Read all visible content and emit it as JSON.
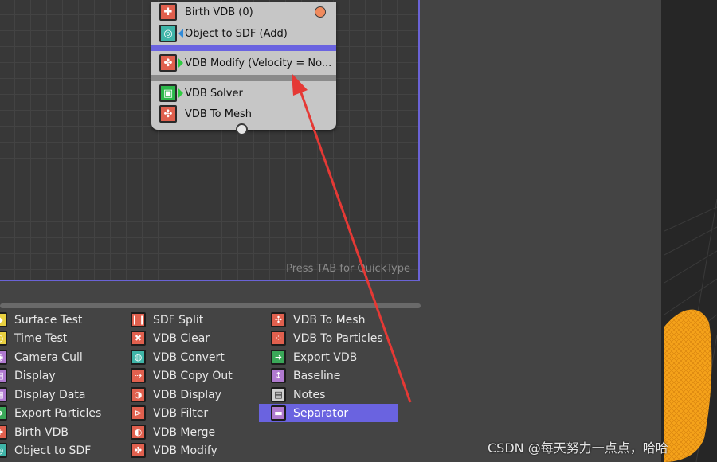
{
  "node": {
    "rows": [
      {
        "label": "Birth VDB (0)",
        "icon": "birth-vdb-icon"
      },
      {
        "label": "Object to SDF (Add)",
        "icon": "object-to-sdf-icon"
      },
      {
        "label": "VDB Modify (Velocity = No...",
        "icon": "vdb-modify-icon"
      },
      {
        "label": "VDB Solver",
        "icon": "vdb-solver-icon"
      },
      {
        "label": "VDB To Mesh",
        "icon": "vdb-to-mesh-icon"
      }
    ]
  },
  "editor": {
    "hint": "Press TAB for QuickType"
  },
  "palette": {
    "col1": [
      {
        "label": "Surface Test",
        "icon": "surface-test-icon"
      },
      {
        "label": "Time Test",
        "icon": "time-test-icon"
      },
      {
        "label": "Camera Cull",
        "icon": "camera-cull-icon"
      },
      {
        "label": "Display",
        "icon": "display-icon"
      },
      {
        "label": "Display Data",
        "icon": "display-data-icon"
      },
      {
        "label": "Export Particles",
        "icon": "export-particles-icon"
      },
      {
        "label": "Birth VDB",
        "icon": "birth-vdb-icon"
      },
      {
        "label": "Object to SDF",
        "icon": "object-to-sdf-icon"
      }
    ],
    "col2": [
      {
        "label": "SDF Split",
        "icon": "sdf-split-icon"
      },
      {
        "label": "VDB Clear",
        "icon": "vdb-clear-icon"
      },
      {
        "label": "VDB Convert",
        "icon": "vdb-convert-icon"
      },
      {
        "label": "VDB Copy Out",
        "icon": "vdb-copy-out-icon"
      },
      {
        "label": "VDB Display",
        "icon": "vdb-display-icon"
      },
      {
        "label": "VDB Filter",
        "icon": "vdb-filter-icon"
      },
      {
        "label": "VDB Merge",
        "icon": "vdb-merge-icon"
      },
      {
        "label": "VDB Modify",
        "icon": "vdb-modify-icon"
      }
    ],
    "col3": [
      {
        "label": "VDB To Mesh",
        "icon": "vdb-to-mesh-icon"
      },
      {
        "label": "VDB To Particles",
        "icon": "vdb-to-particles-icon"
      },
      {
        "label": "Export VDB",
        "icon": "export-vdb-icon"
      },
      {
        "label": "Baseline",
        "icon": "baseline-icon"
      },
      {
        "label": "Notes",
        "icon": "notes-icon"
      },
      {
        "label": "Separator",
        "icon": "separator-icon"
      }
    ]
  },
  "watermark": "CSDN @每天努力一点点，哈哈",
  "colors": {
    "accent": "#6a63e0",
    "arrow": "#e53935",
    "viewport_object": "#f5a21a"
  }
}
